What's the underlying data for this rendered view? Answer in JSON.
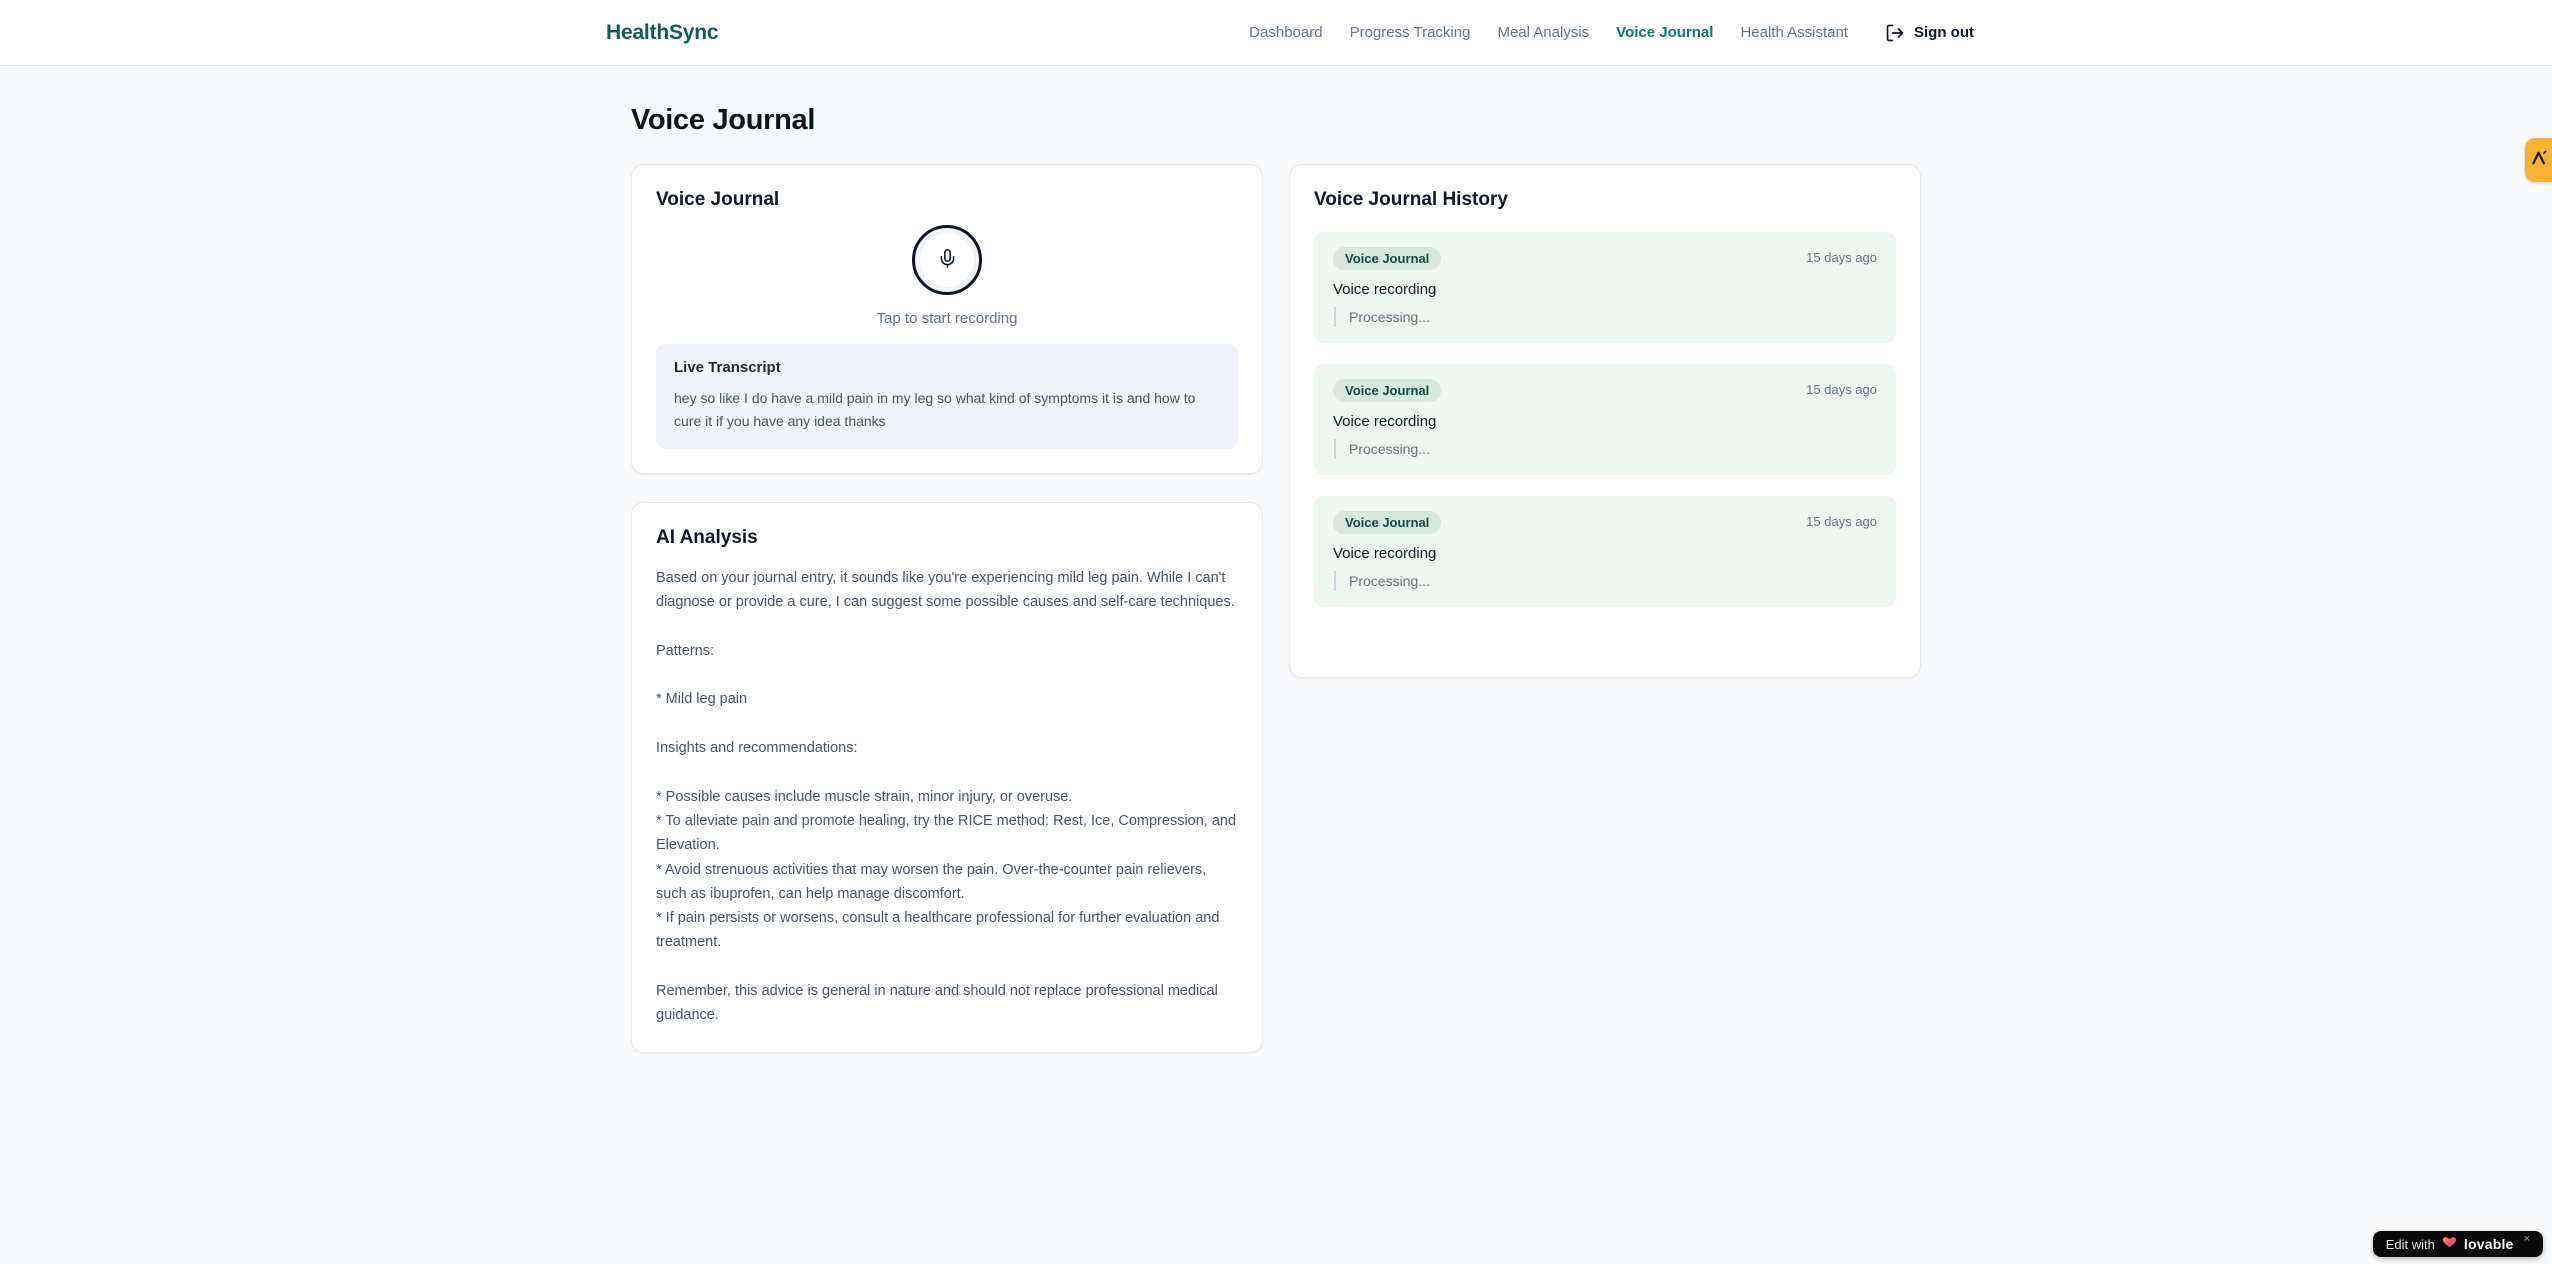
{
  "brand": {
    "name": "HealthSync"
  },
  "nav": {
    "items": [
      {
        "label": "Dashboard",
        "active": false
      },
      {
        "label": "Progress Tracking",
        "active": false
      },
      {
        "label": "Meal Analysis",
        "active": false
      },
      {
        "label": "Voice Journal",
        "active": true
      },
      {
        "label": "Health Assistant",
        "active": false
      }
    ],
    "sign_out_label": "Sign out"
  },
  "page": {
    "title": "Voice Journal"
  },
  "recorder_card": {
    "title": "Voice Journal",
    "tap_hint": "Tap to start recording",
    "live_transcript_title": "Live Transcript",
    "live_transcript_text": "hey so like I do have a mild pain in my leg so what kind of symptoms it is and how to cure it if you have any idea thanks"
  },
  "analysis_card": {
    "title": "AI Analysis",
    "body": "Based on your journal entry, it sounds like you're experiencing mild leg pain. While I can't diagnose or provide a cure, I can suggest some possible causes and self-care techniques.\n\nPatterns:\n\n* Mild leg pain\n\nInsights and recommendations:\n\n* Possible causes include muscle strain, minor injury, or overuse.\n* To alleviate pain and promote healing, try the RICE method: Rest, Ice, Compression, and Elevation.\n* Avoid strenuous activities that may worsen the pain. Over-the-counter pain relievers, such as ibuprofen, can help manage discomfort.\n* If pain persists or worsens, consult a healthcare professional for further evaluation and treatment.\n\nRemember, this advice is general in nature and should not replace professional medical guidance."
  },
  "history": {
    "title": "Voice Journal History",
    "entries": [
      {
        "badge": "Voice Journal",
        "time": "15 days ago",
        "label": "Voice recording",
        "status": "Processing..."
      },
      {
        "badge": "Voice Journal",
        "time": "15 days ago",
        "label": "Voice recording",
        "status": "Processing..."
      },
      {
        "badge": "Voice Journal",
        "time": "15 days ago",
        "label": "Voice recording",
        "status": "Processing..."
      }
    ]
  },
  "overlays": {
    "lovable_badge": {
      "prefix": "Edit with",
      "brand": "lovable",
      "close_label": "×",
      "heart_icon": "heart-icon"
    },
    "side_tab": {
      "icon": "lambda-logo-icon"
    }
  },
  "colors": {
    "brand_teal": "#0f5e53",
    "nav_active_teal": "#0f766e",
    "page_bg": "#f8fafc",
    "card_border": "#e7eaf0",
    "entry_bg": "#eff7f1",
    "badge_bg": "#d7e8de",
    "badge_text": "#134e4a",
    "muted_text": "#64748b",
    "body_text": "#475569",
    "heading_text": "#0f172a",
    "side_tab_amber": "#f9b234",
    "lovable_bg": "#0a0a0b"
  }
}
